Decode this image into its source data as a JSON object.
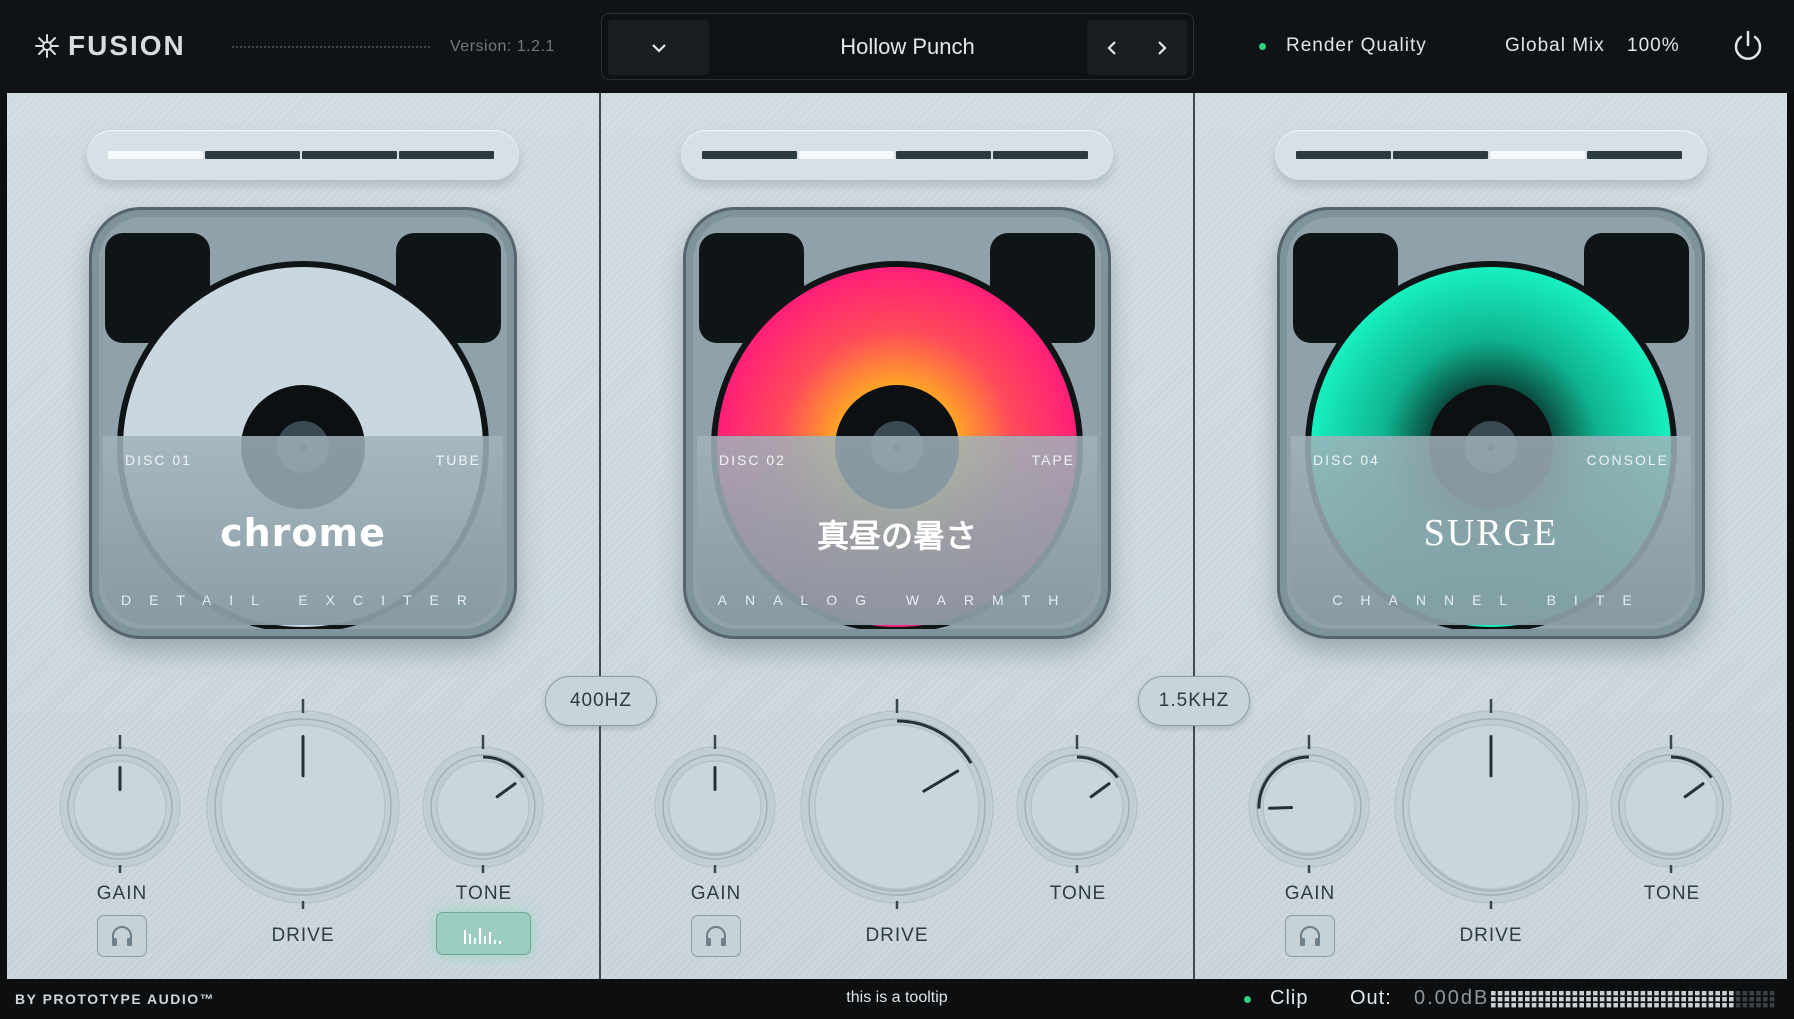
{
  "header": {
    "brand": "FUSION",
    "version": "Version: 1.2.1",
    "preset_name": "Hollow Punch",
    "render_quality": "Render Quality",
    "global_mix_label": "Global Mix",
    "global_mix_value": "100%"
  },
  "bands": [
    {
      "segment_active": 1,
      "disc_label": "DISC 01",
      "type_label": "TUBE",
      "title": "chrome",
      "subtitle": "DETAIL EXCITER",
      "gain_label": "GAIN",
      "drive_label": "DRIVE",
      "tone_label": "TONE",
      "disc_color": "#c9d8e0",
      "gain_level": 0.5,
      "drive_level": 0.5,
      "tone_level": 0.7
    },
    {
      "segment_active": 2,
      "disc_label": "DISC 02",
      "type_label": "TAPE",
      "title": "真昼の暑さ",
      "subtitle": "ANALOG WARMTH",
      "gain_label": "GAIN",
      "drive_label": "DRIVE",
      "tone_label": "TONE",
      "disc_color": "#ff2a6d",
      "gain_level": 0.5,
      "drive_level": 0.72,
      "tone_level": 0.7
    },
    {
      "segment_active": 3,
      "disc_label": "DISC 04",
      "type_label": "CONSOLE",
      "title": "SURGE",
      "subtitle": "CHANNEL BITE",
      "gain_label": "GAIN",
      "drive_label": "DRIVE",
      "tone_label": "TONE",
      "disc_color": "#14e8b8",
      "gain_level": 0.16,
      "drive_level": 0.5,
      "tone_level": 0.7
    }
  ],
  "crossovers": [
    "400HZ",
    "1.5KHZ"
  ],
  "footer": {
    "byline": "BY PROTOTYPE AUDIO™",
    "tooltip": "this is a tooltip",
    "clip_label": "Clip",
    "out_label": "Out:",
    "out_value": "0.00dB"
  },
  "colors": {
    "accent_green": "#2fd17f",
    "panel_bg": "#cfd9de",
    "topbar_bg": "#101315"
  }
}
